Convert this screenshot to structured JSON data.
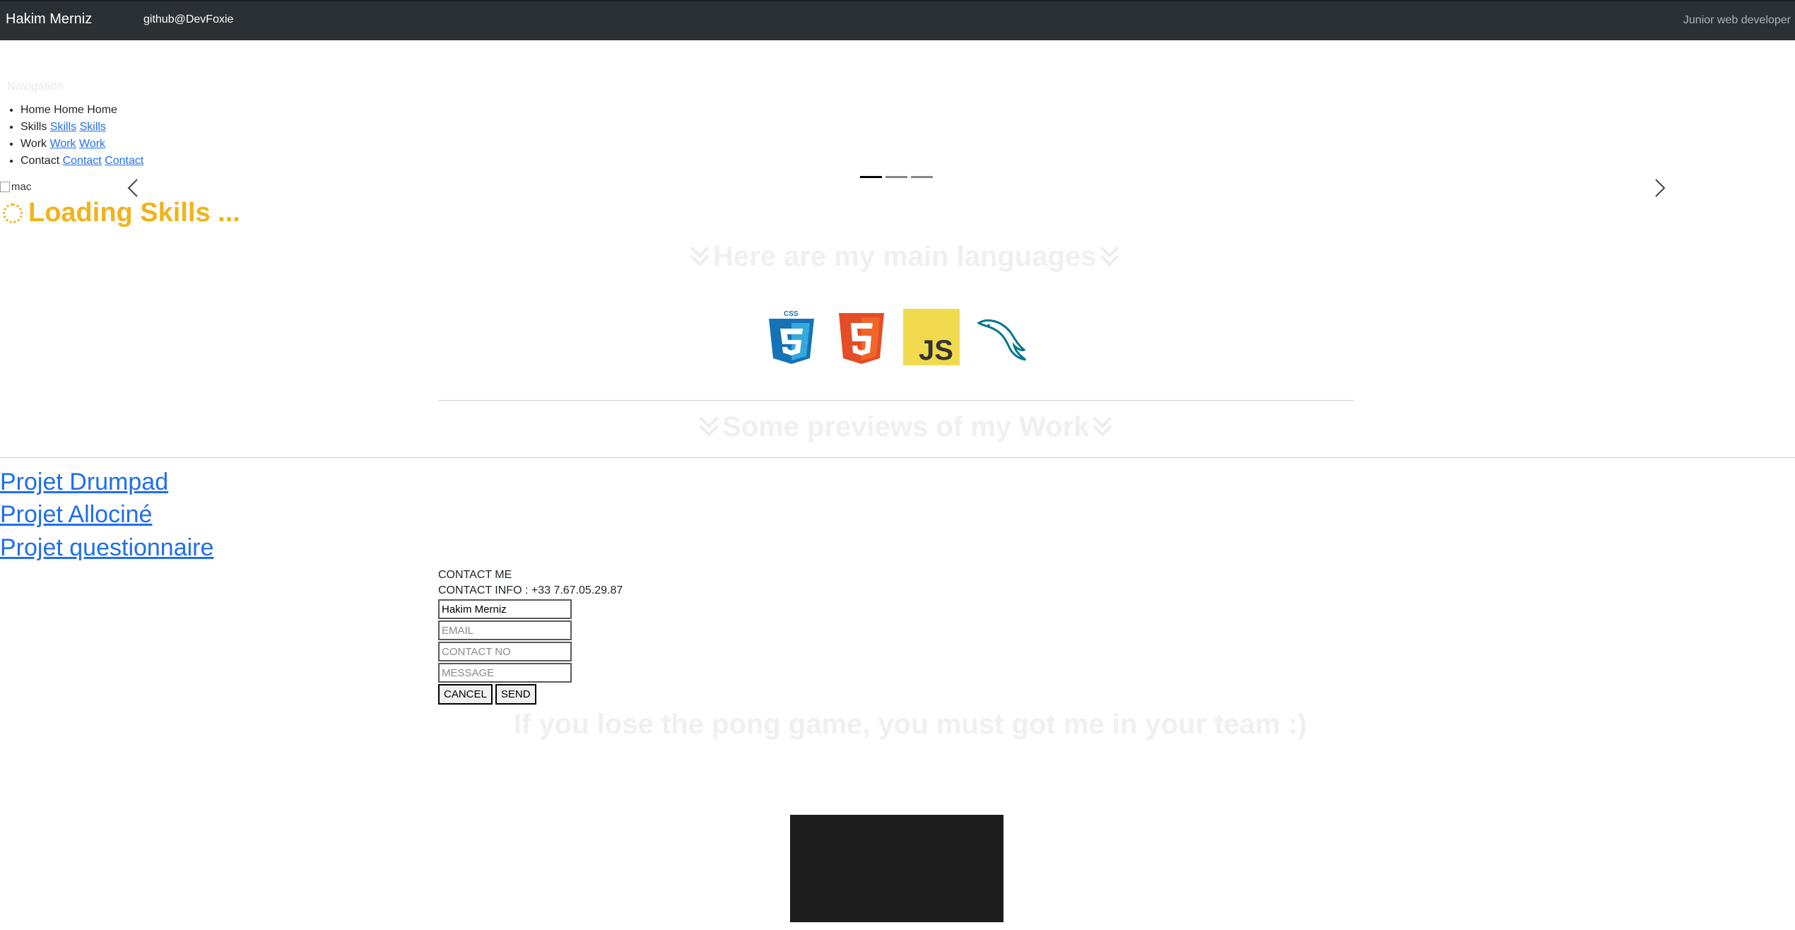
{
  "navbar": {
    "brand": "Hakim Merniz",
    "github": "github@DevFoxie",
    "role": "Junior web developer"
  },
  "faint_nav_label": "Navigation",
  "nav_list": [
    {
      "text": "Home Home Home",
      "links": []
    },
    {
      "text": "Skills",
      "links": [
        "Skills",
        "Skills"
      ]
    },
    {
      "text": "Work",
      "links": [
        "Work",
        "Work"
      ]
    },
    {
      "text": "Contact",
      "links": [
        "Contact",
        "Contact"
      ]
    }
  ],
  "carousel": {
    "image_alt": "mac",
    "slides": 3,
    "active_slide": 1
  },
  "loading": {
    "text": "Loading Skills ..."
  },
  "sections": {
    "languages_heading": "Here are my main languages",
    "work_heading": "Some previews of my Work"
  },
  "languages": [
    {
      "icon": "css3-icon",
      "label": "CSS",
      "color": "#1572B6"
    },
    {
      "icon": "html5-icon",
      "color": "#E44D26"
    },
    {
      "icon": "javascript-icon",
      "label": "JS",
      "color": "#F0DB4F"
    },
    {
      "icon": "mysql-dolphin-icon",
      "color": "#00758F"
    }
  ],
  "projects": [
    "Projet Drumpad",
    "Projet Allociné",
    "Projet questionnaire"
  ],
  "contact": {
    "title": "CONTACT ME",
    "info": "CONTACT INFO : +33 7.67.05.29.87",
    "name_value": "Hakim Merniz",
    "email_placeholder": "EMAIL",
    "phone_placeholder": "CONTACT NO",
    "message_placeholder": "MESSAGE",
    "cancel_label": "CANCEL",
    "send_label": "SEND"
  },
  "pong": {
    "text": "If you lose the pong game, you must got me in your team :)"
  },
  "colors": {
    "navbar_bg": "#2b3035",
    "accent_yellow": "#f0b31b",
    "link": "#1f6feb"
  }
}
